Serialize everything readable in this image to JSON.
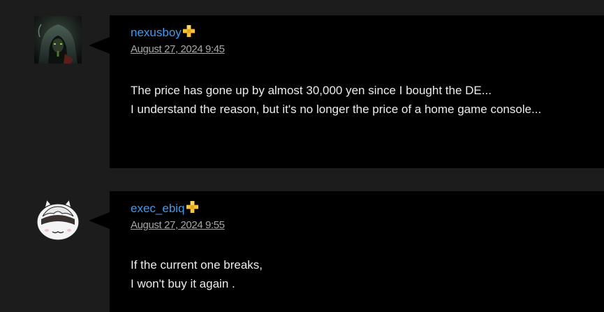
{
  "comments": [
    {
      "author": "nexusboy",
      "plus_member": true,
      "timestamp": "August 27, 2024 9:45",
      "lines": [
        "The price has gone up by almost 30,000 yen since I bought the DE...",
        "I understand the reason, but it's no longer the price of a home game console..."
      ]
    },
    {
      "author": "exec_ebiq",
      "plus_member": true,
      "timestamp": "August 27, 2024 9:55",
      "lines": [
        "If the current one breaks,",
        "I won't buy it again ."
      ]
    }
  ],
  "colors": {
    "page_background": "#1c1c1c",
    "bubble_background": "#000000",
    "username": "#3e9bf2",
    "timestamp": "#a8a8a8",
    "body_text": "#ececec",
    "plus_badge": "#f6c33b"
  }
}
